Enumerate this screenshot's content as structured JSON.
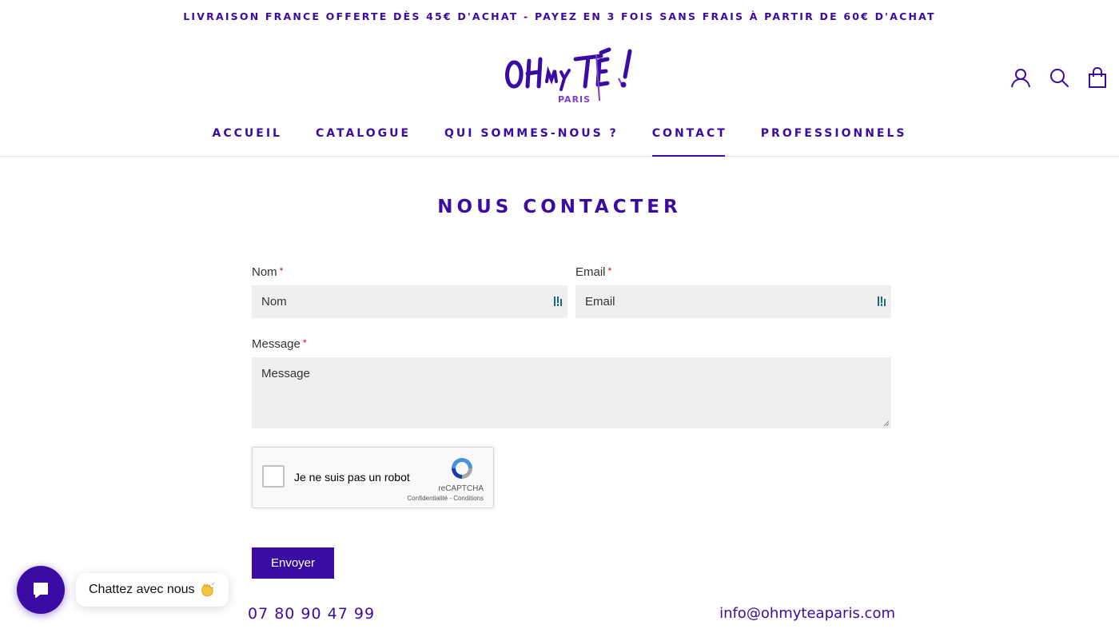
{
  "announcement": "LIVRAISON FRANCE OFFERTE DÈS 45€ D'ACHAT - PAYEZ EN 3 FOIS SANS FRAIS À PARTIR DE 60€ D'ACHAT",
  "logo": {
    "text": "OH MY TEA !",
    "subtext": "PARIS"
  },
  "header_icons": [
    "account-icon",
    "search-icon",
    "cart-icon"
  ],
  "nav": {
    "items": [
      {
        "label": "ACCUEIL",
        "active": false
      },
      {
        "label": "CATALOGUE",
        "active": false
      },
      {
        "label": "QUI SOMMES-NOUS ?",
        "active": false
      },
      {
        "label": "CONTACT",
        "active": true
      },
      {
        "label": "PROFESSIONNELS",
        "active": false
      }
    ]
  },
  "page_title": "NOUS CONTACTER",
  "form": {
    "name": {
      "label": "Nom",
      "required": "*",
      "placeholder": "Nom"
    },
    "email": {
      "label": "Email",
      "required": "*",
      "placeholder": "Email"
    },
    "message": {
      "label": "Message",
      "required": "*",
      "placeholder": "Message"
    },
    "captcha": {
      "label": "Je ne suis pas un robot",
      "brand": "reCAPTCHA",
      "links": "Confidentialité - Conditions"
    },
    "submit_label": "Envoyer"
  },
  "contact": {
    "phone": "07 80 90 47 99",
    "email": "info@ohmyteaparis.com"
  },
  "chat": {
    "label": "Chattez avec nous"
  },
  "colors": {
    "brand": "#3a0ca3",
    "field_bg": "#efefef",
    "required": "#dd0000"
  }
}
